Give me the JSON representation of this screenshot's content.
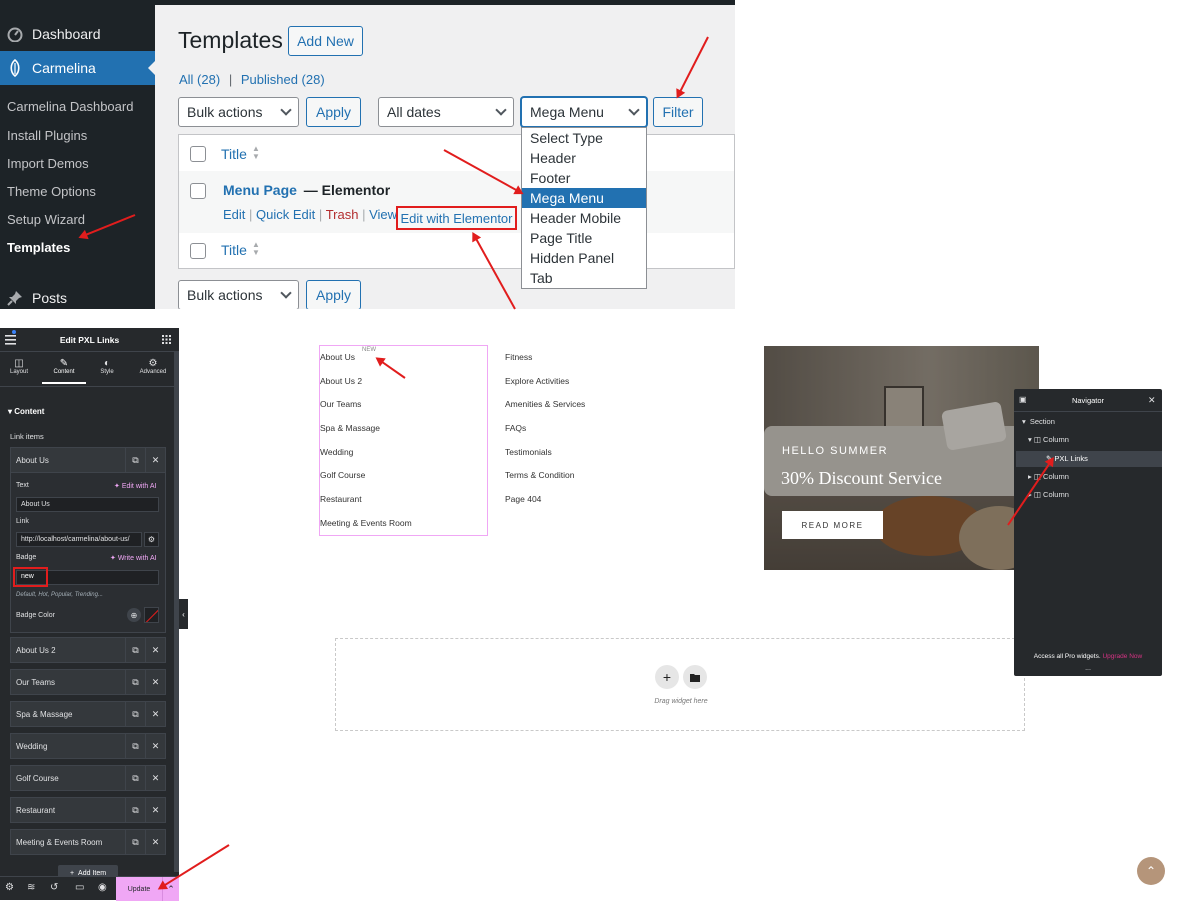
{
  "wp": {
    "sidebar": {
      "dashboard": "Dashboard",
      "carmelina": "Carmelina",
      "submenu": [
        "Carmelina Dashboard",
        "Install Plugins",
        "Import Demos",
        "Theme Options",
        "Setup Wizard",
        "Templates"
      ],
      "posts": "Posts"
    },
    "page_title": "Templates",
    "add_new": "Add New",
    "filters": {
      "all": "All (28)",
      "sep": "|",
      "published": "Published (28)"
    },
    "bulk_actions": "Bulk actions",
    "apply": "Apply",
    "all_dates": "All dates",
    "type_selected": "Mega Menu",
    "filter": "Filter",
    "type_options": [
      "Select Type",
      "Header",
      "Footer",
      "Mega Menu",
      "Header Mobile",
      "Page Title",
      "Hidden Panel",
      "Tab"
    ],
    "column_title": "Title",
    "row": {
      "title": "Menu Page",
      "suffix": "— Elementor",
      "actions": {
        "edit": "Edit",
        "quick_edit": "Quick Edit",
        "trash": "Trash",
        "view": "View",
        "edit_elementor": "Edit with Elementor"
      },
      "sep": "|"
    }
  },
  "elementor": {
    "panel_title": "Edit PXL Links",
    "tabs": [
      "Layout",
      "Content",
      "Style",
      "Advanced"
    ],
    "section": "Content",
    "link_items_label": "Link items",
    "expanded_item": "About Us",
    "text_label": "Text",
    "edit_ai": "Edit with AI",
    "text_value": "About Us",
    "link_label": "Link",
    "link_value": "http://localhost/carmelina/about-us/",
    "badge_label": "Badge",
    "write_ai": "Write with AI",
    "badge_value": "new",
    "badge_hint": "Default, Hot, Popular, Trending...",
    "badge_color_label": "Badge Color",
    "items": [
      "About Us 2",
      "Our Teams",
      "Spa & Massage",
      "Wedding",
      "Golf Course",
      "Restaurant",
      "Meeting & Events Room"
    ],
    "add_item": "Add Item",
    "update": "Update"
  },
  "canvas": {
    "col1": [
      "About Us",
      "About Us 2",
      "Our Teams",
      "Spa & Massage",
      "Wedding",
      "Golf Course",
      "Restaurant",
      "Meeting & Events Room"
    ],
    "new_badge": "NEW",
    "col2": [
      "Fitness",
      "Explore Activities",
      "Amenities & Services",
      "FAQs",
      "Testimonials",
      "Terms & Condition",
      "Page 404"
    ],
    "banner_kicker": "HELLO SUMMER",
    "banner_title": "30% Discount Service",
    "banner_button": "READ MORE",
    "drag_hint": "Drag widget here"
  },
  "navigator": {
    "title": "Navigator",
    "tree": [
      "Section",
      "Column",
      "PXL Links",
      "Column",
      "Column"
    ],
    "footer": "Access all Pro widgets.",
    "upgrade": "Upgrade Now",
    "dots": "..."
  },
  "colors": {
    "wp_blue": "#2271b1",
    "accent_pink": "#f0a7f5",
    "arrow_red": "#e11d1d"
  }
}
